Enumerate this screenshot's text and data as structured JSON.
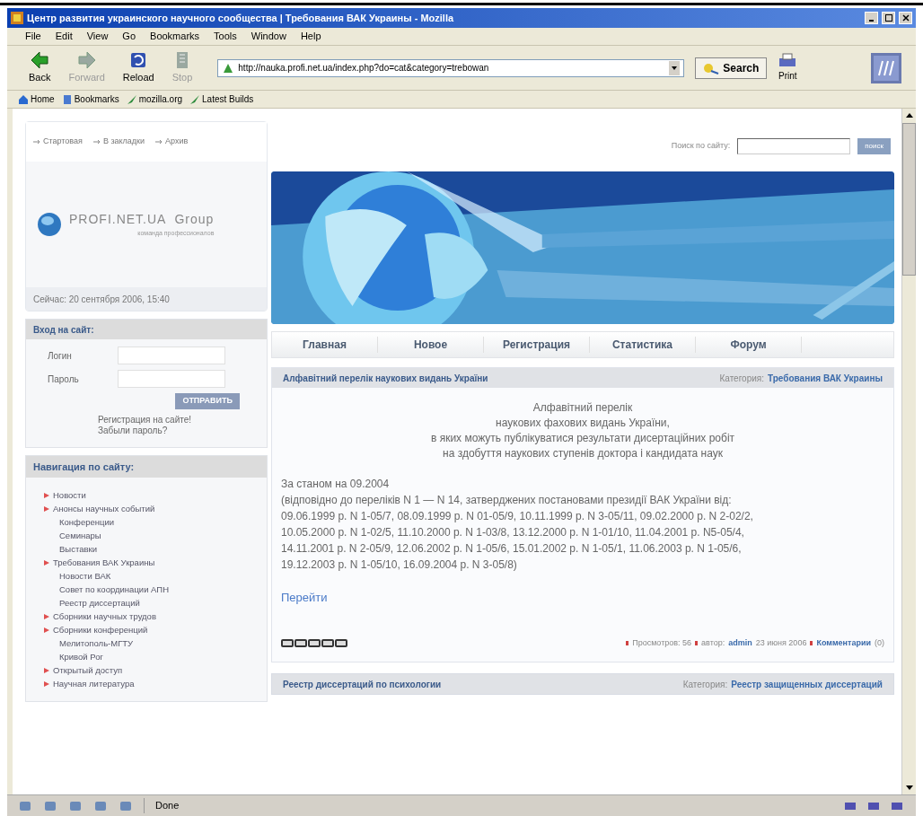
{
  "window": {
    "title": "Центр развития украинского научного сообщества | Требования ВАК Украины - Mozilla"
  },
  "menu": [
    "File",
    "Edit",
    "View",
    "Go",
    "Bookmarks",
    "Tools",
    "Window",
    "Help"
  ],
  "toolbar": {
    "buttons": [
      {
        "kind": "back",
        "label": "Back",
        "disabled": false
      },
      {
        "kind": "forward",
        "label": "Forward",
        "disabled": true
      },
      {
        "kind": "reload",
        "label": "Reload",
        "disabled": false
      },
      {
        "kind": "stop",
        "label": "Stop",
        "disabled": true
      }
    ],
    "address": "http://nauka.profi.net.ua/index.php?do=cat&category=trebowan",
    "search": "Search",
    "print": "Print"
  },
  "bookmarks": [
    {
      "kind": "home",
      "label": "Home"
    },
    {
      "kind": "bookmarks",
      "label": "Bookmarks"
    },
    {
      "kind": "link",
      "label": "mozilla.org"
    },
    {
      "kind": "link",
      "label": "Latest Builds"
    }
  ],
  "page": {
    "top_links": [
      "Стартовая",
      "В закладки",
      "Архив"
    ],
    "logo": {
      "name": "PROFI.NET.UA  Group",
      "tagline": "команда профессионалов"
    },
    "date": "Сейчас: 20 сентября 2006, 15:40",
    "search": {
      "label": "Поиск по сайту:",
      "button": "поиск"
    },
    "tabs": [
      "Главная",
      "Новое",
      "Регистрация",
      "Статистика",
      "Форум"
    ],
    "login": {
      "title": "Вход на сайт:",
      "fields": [
        "Логин",
        "Пароль"
      ],
      "submit": "ОТПРАВИТЬ",
      "links": [
        "Регистрация на сайте!",
        "Забыли пароль?"
      ]
    },
    "navigation": {
      "title": "Навигация по сайту:",
      "items": [
        {
          "label": "Новости"
        },
        {
          "label": "Анонсы научных событий",
          "children": [
            {
              "label": "Конференции"
            },
            {
              "label": "Семинары"
            },
            {
              "label": "Выставки"
            }
          ]
        },
        {
          "label": "Требования ВАК Украины",
          "children": [
            {
              "label": "Новости ВАК"
            },
            {
              "label": "Совет по координации АПН"
            },
            {
              "label": "Реестр диссертаций"
            }
          ]
        },
        {
          "label": "Сборники научных трудов"
        },
        {
          "label": "Сборники конференций",
          "children": [
            {
              "label": "Мелитополь-МГТУ"
            },
            {
              "label": "Кривой Рог"
            }
          ]
        },
        {
          "label": "Открытый доступ"
        },
        {
          "label": "Научная литература"
        }
      ]
    },
    "article": {
      "title": "Алфавітний перелік наукових видань України",
      "category_label": "Категория:",
      "category": "Требования ВАК Украины",
      "heading": [
        "Алфавітний перелік",
        "наукових фахових видань України,",
        "в яких можуть публікуватися результати дисертаційних робіт",
        "на здобуття наукових ступенів доктора і кандидата наук"
      ],
      "body": [
        "За станом на 09.2004",
        "(відповідно до переліків N 1 — N 14, затверджених постановами президії ВАК України від:",
        "09.06.1999 р. N 1-05/7, 08.09.1999 р. N 01-05/9, 10.11.1999 р. N 3-05/11, 09.02.2000 р. N 2-02/2,",
        "10.05.2000 р. N 1-02/5, 11.10.2000 р. N 1-03/8, 13.12.2000 р. N 1-01/10, 11.04.2001 р. N5-05/4,",
        "14.11.2001 р. N 2-05/9, 12.06.2002 р. N 1-05/6, 15.01.2002 р. N 1-05/1, 11.06.2003 р. N 1-05/6,",
        "19.12.2003 р. N 1-05/10, 16.09.2004 р. N 3-05/8)"
      ],
      "link": "Перейти",
      "stars": 0,
      "views": "Просмотров: 56",
      "author_label": "автор:",
      "author": "admin",
      "date": "23 июня 2006",
      "comments": "Комментарии",
      "comments_count": "(0)"
    },
    "next_article": {
      "title": "Реестр диссертаций по психологии",
      "category_label": "Категория:",
      "category": "Реестр защищенных диссертаций"
    }
  },
  "status_bar": {
    "text": "Done"
  }
}
